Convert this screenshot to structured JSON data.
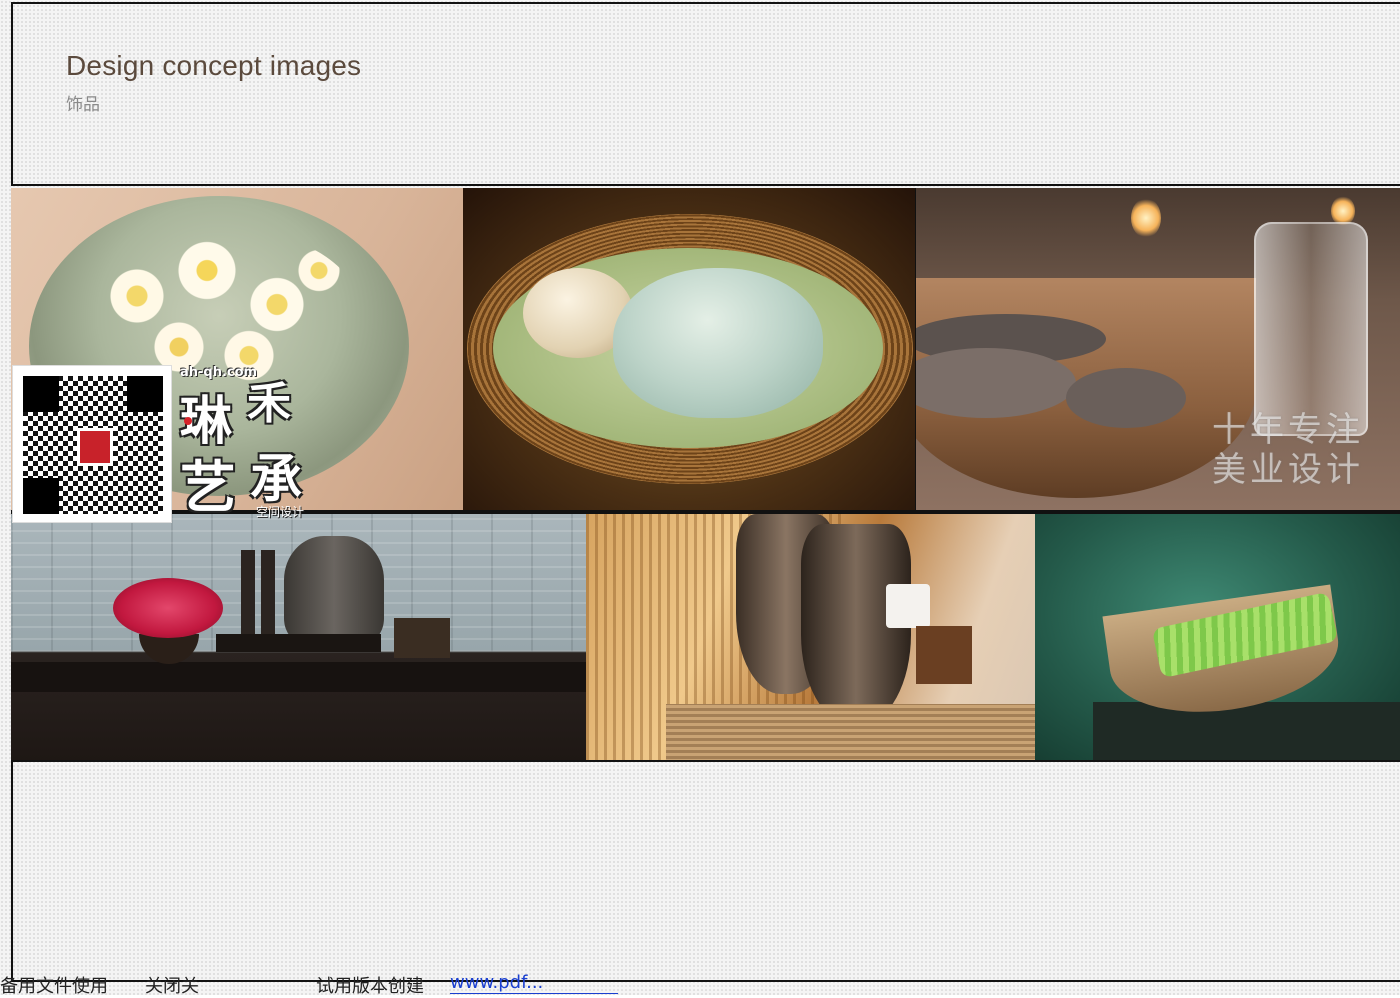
{
  "header": {
    "title": "Design concept images",
    "subtitle": "饰品"
  },
  "gallery": {
    "photos": [
      {
        "name": "floating flowers in bowl"
      },
      {
        "name": "teapot in woven basket"
      },
      {
        "name": "spa stones and oil bottle"
      },
      {
        "name": "altar with flowers and urn"
      },
      {
        "name": "wooden vases"
      },
      {
        "name": "bowl with green stalks"
      }
    ],
    "watermark_line1": "十年专注",
    "watermark_line2": "美业设计"
  },
  "logo": {
    "url": "ah-qh.com",
    "char1": "琳",
    "char2": "禾",
    "char3": "艺",
    "char4": "承",
    "tagline": "空间设计"
  },
  "footer": {
    "text1": "备用文件使用",
    "text2": "关闭关",
    "text3": "试用版本创建",
    "link": "www.pdf..."
  }
}
